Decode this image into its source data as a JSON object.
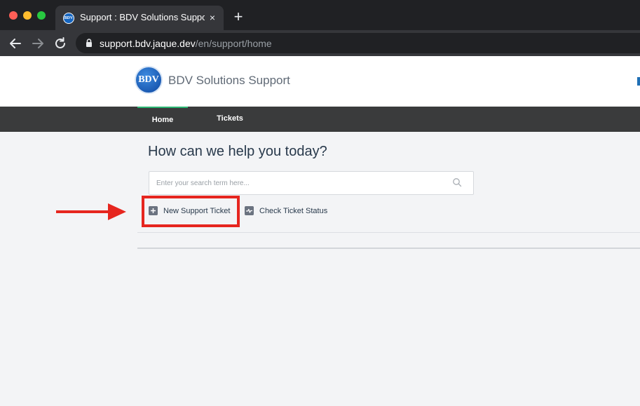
{
  "browser": {
    "tab_title": "Support : BDV Solutions Support",
    "tab_favicon_text": "BDV",
    "new_tab_symbol": "+",
    "close_symbol": "×",
    "url_host": "support.bdv.jaque.dev",
    "url_path": "/en/support/home"
  },
  "header": {
    "logo_text": "BDV",
    "site_title": "BDV Solutions Support",
    "accent_color": "#2bb673"
  },
  "nav": {
    "items": [
      {
        "label": "Home",
        "active": true
      },
      {
        "label": "Tickets",
        "active": false
      }
    ]
  },
  "main": {
    "title": "How can we help you today?",
    "search_placeholder": "Enter your search term here...",
    "actions": [
      {
        "label": "New Support Ticket",
        "icon": "plus-icon"
      },
      {
        "label": "Check Ticket Status",
        "icon": "activity-icon"
      }
    ]
  },
  "annotation": {
    "highlight_color": "#e6261f",
    "arrow_color": "#e6261f"
  }
}
